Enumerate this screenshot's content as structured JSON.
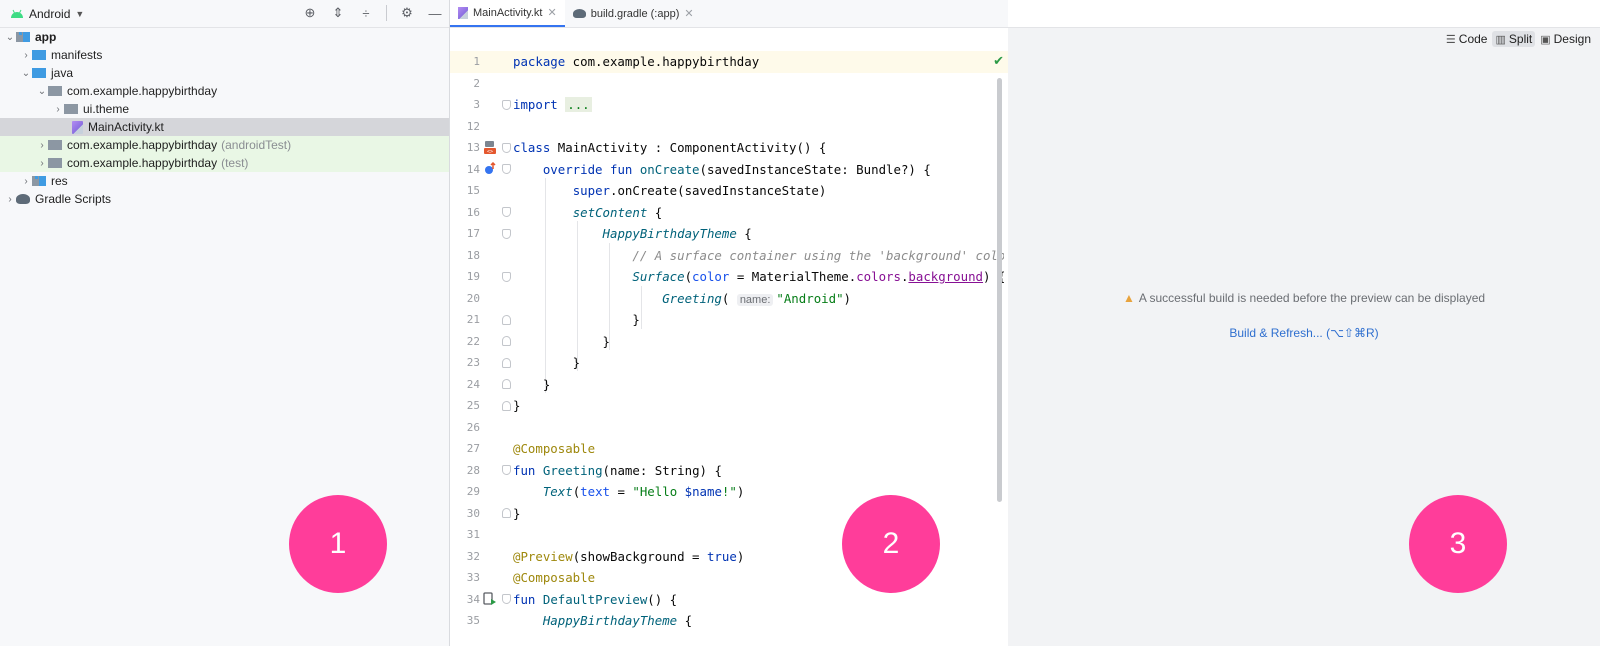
{
  "project": {
    "view": "Android",
    "tree": [
      {
        "label": "app",
        "bold": true
      },
      {
        "label": "manifests"
      },
      {
        "label": "java"
      },
      {
        "label": "com.example.happybirthday"
      },
      {
        "label": "ui.theme"
      },
      {
        "label": "MainActivity.kt"
      },
      {
        "label": "com.example.happybirthday",
        "suffix": "(androidTest)"
      },
      {
        "label": "com.example.happybirthday",
        "suffix": "(test)"
      },
      {
        "label": "res"
      },
      {
        "label": "Gradle Scripts"
      }
    ]
  },
  "tabs": [
    {
      "label": "MainActivity.kt",
      "active": true
    },
    {
      "label": "build.gradle (:app)",
      "active": false
    }
  ],
  "code": {
    "line_numbers": [
      "1",
      "2",
      "3",
      "12",
      "13",
      "14",
      "15",
      "16",
      "17",
      "18",
      "19",
      "20",
      "21",
      "22",
      "23",
      "24",
      "25",
      "26",
      "27",
      "28",
      "29",
      "30",
      "31",
      "32",
      "33",
      "34",
      "35"
    ]
  },
  "preview": {
    "modes": [
      "Code",
      "Split",
      "Design"
    ],
    "active_mode": "Split",
    "message": "A successful build is needed before the preview can be displayed",
    "action": "Build & Refresh... (⌥⇧⌘R)"
  },
  "callouts": [
    "1",
    "2",
    "3"
  ],
  "colors": {
    "callout": "#ff3d9a",
    "selection": "#d5d6da",
    "test_highlight": "#e9f7e5",
    "link": "#2f6fcf"
  }
}
